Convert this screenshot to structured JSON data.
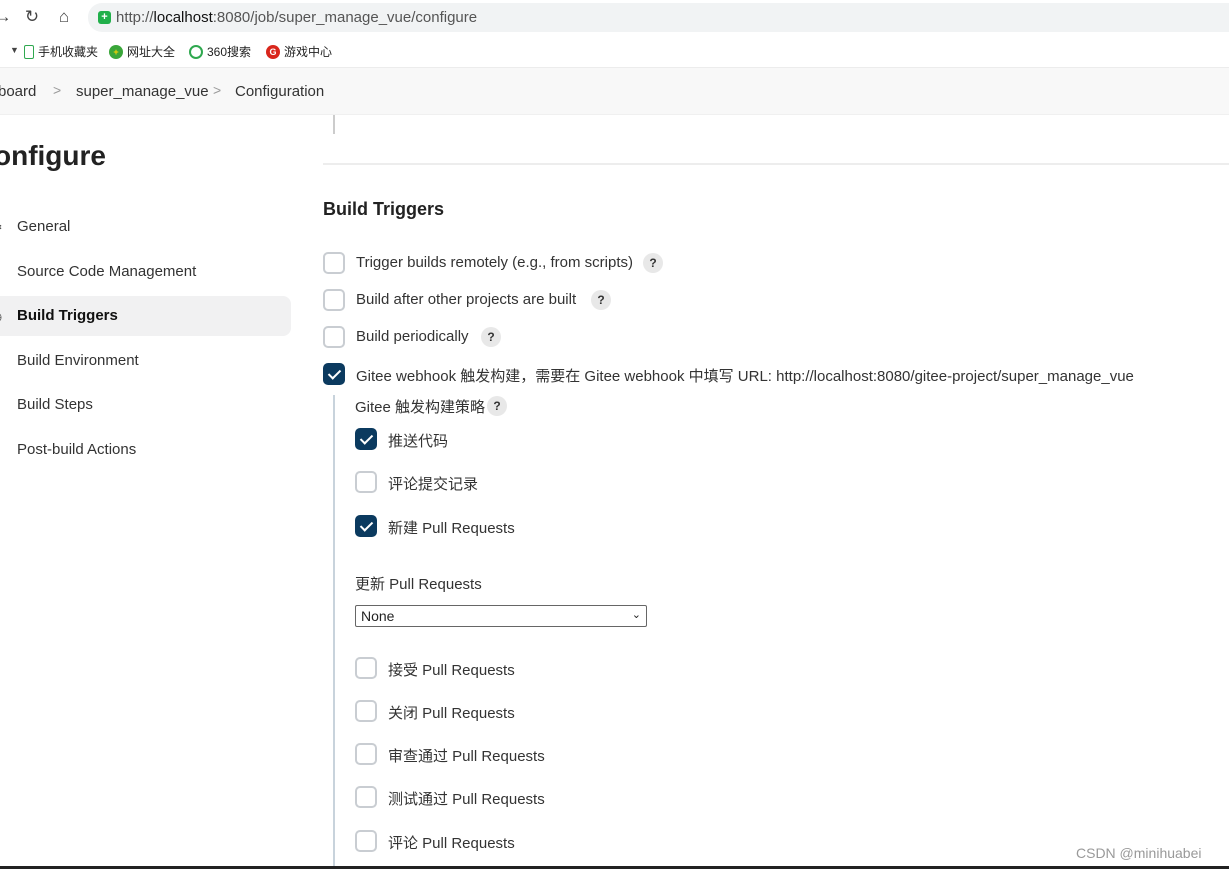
{
  "browser": {
    "url_prefix": "http://",
    "url_host": "localhost",
    "url_rest": ":8080/job/super_manage_vue/configure",
    "bookmarks": [
      {
        "label": "手机收藏夹",
        "icon": "phone-icon"
      },
      {
        "label": "网址大全",
        "icon": "url-directory-icon"
      },
      {
        "label": "360搜索",
        "icon": "search-360-icon"
      },
      {
        "label": "游戏中心",
        "icon": "game-center-icon"
      }
    ]
  },
  "breadcrumb": {
    "items": [
      "board",
      "super_manage_vue",
      "Configuration"
    ]
  },
  "sidebar": {
    "title": "onfigure",
    "items": [
      {
        "label": "General",
        "icon": "gear-icon",
        "active": false
      },
      {
        "label": "Source Code Management",
        "icon": "code-icon",
        "active": false
      },
      {
        "label": "Build Triggers",
        "icon": "clock-icon",
        "active": true
      },
      {
        "label": "Build Environment",
        "icon": "environment-icon",
        "active": false
      },
      {
        "label": "Build Steps",
        "icon": "steps-icon",
        "active": false
      },
      {
        "label": "Post-build Actions",
        "icon": "cube-icon",
        "active": false
      }
    ]
  },
  "main": {
    "section_title": "Build Triggers",
    "triggers": [
      {
        "label": "Trigger builds remotely (e.g., from scripts)",
        "checked": false,
        "help": "?"
      },
      {
        "label": "Build after other projects are built",
        "checked": false,
        "help": "?"
      },
      {
        "label": "Build periodically",
        "checked": false,
        "help": "?"
      },
      {
        "label": "Gitee webhook 触发构建，需要在 Gitee webhook 中填写 URL: http://localhost:8080/gitee-project/super_manage_vue",
        "checked": true
      }
    ],
    "gitee": {
      "strategy_label": "Gitee 触发构建策略",
      "strategy_help": "?",
      "options_a": [
        {
          "label": "推送代码",
          "checked": true
        },
        {
          "label": "评论提交记录",
          "checked": false
        },
        {
          "label": "新建 Pull Requests",
          "checked": true
        }
      ],
      "update_label": "更新 Pull Requests",
      "update_select_value": "None",
      "options_b": [
        {
          "label": "接受 Pull Requests",
          "checked": false
        },
        {
          "label": "关闭 Pull Requests",
          "checked": false
        },
        {
          "label": "审查通过 Pull Requests",
          "checked": false
        },
        {
          "label": "测试通过 Pull Requests",
          "checked": false
        },
        {
          "label": "评论 Pull Requests",
          "checked": false
        }
      ]
    }
  },
  "watermark": "CSDN @minihuabei",
  "colors": {
    "checkbox_checked": "#0b3a5f",
    "secure": "#21b04b"
  }
}
